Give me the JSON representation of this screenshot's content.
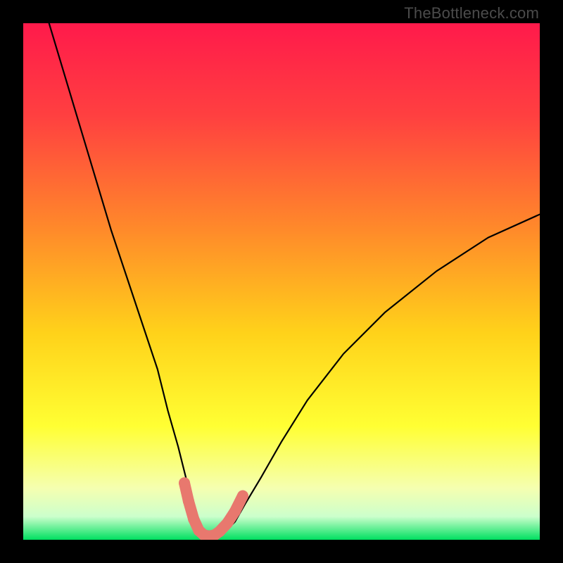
{
  "watermark": "TheBottleneck.com",
  "chart_data": {
    "type": "line",
    "title": "",
    "xlabel": "",
    "ylabel": "",
    "xlim": [
      0,
      100
    ],
    "ylim": [
      0,
      100
    ],
    "background_gradient": {
      "stops": [
        {
          "offset": 0.0,
          "color": "#ff1a4b"
        },
        {
          "offset": 0.18,
          "color": "#ff4040"
        },
        {
          "offset": 0.4,
          "color": "#ff8a2a"
        },
        {
          "offset": 0.6,
          "color": "#ffd21a"
        },
        {
          "offset": 0.78,
          "color": "#ffff33"
        },
        {
          "offset": 0.9,
          "color": "#f5ffb0"
        },
        {
          "offset": 0.955,
          "color": "#ccffcc"
        },
        {
          "offset": 1.0,
          "color": "#00e060"
        }
      ]
    },
    "series": [
      {
        "name": "bottleneck-curve",
        "type": "line",
        "color": "#000000",
        "x": [
          5,
          8,
          11,
          14,
          17,
          20,
          23,
          26,
          28,
          30,
          31.5,
          33,
          34,
          35,
          36,
          37,
          39,
          41,
          43,
          46,
          50,
          55,
          62,
          70,
          80,
          90,
          100
        ],
        "y": [
          100,
          90,
          80,
          70,
          60,
          51,
          42,
          33,
          25,
          18,
          12,
          7,
          3.5,
          1.5,
          0.5,
          0.5,
          1.5,
          3.5,
          7,
          12,
          19,
          27,
          36,
          44,
          52,
          58.5,
          63
        ]
      },
      {
        "name": "optimal-range-marker",
        "type": "line",
        "color": "#e8786e",
        "stroke_width": 16,
        "x": [
          31.2,
          32.0,
          33.0,
          34.0,
          35.0,
          36.0,
          37.0,
          38.0,
          39.5,
          41.0,
          42.5
        ],
        "y": [
          11.0,
          7.5,
          4.0,
          1.8,
          0.9,
          0.7,
          0.9,
          1.6,
          3.2,
          5.5,
          8.5
        ]
      }
    ],
    "annotations": []
  }
}
